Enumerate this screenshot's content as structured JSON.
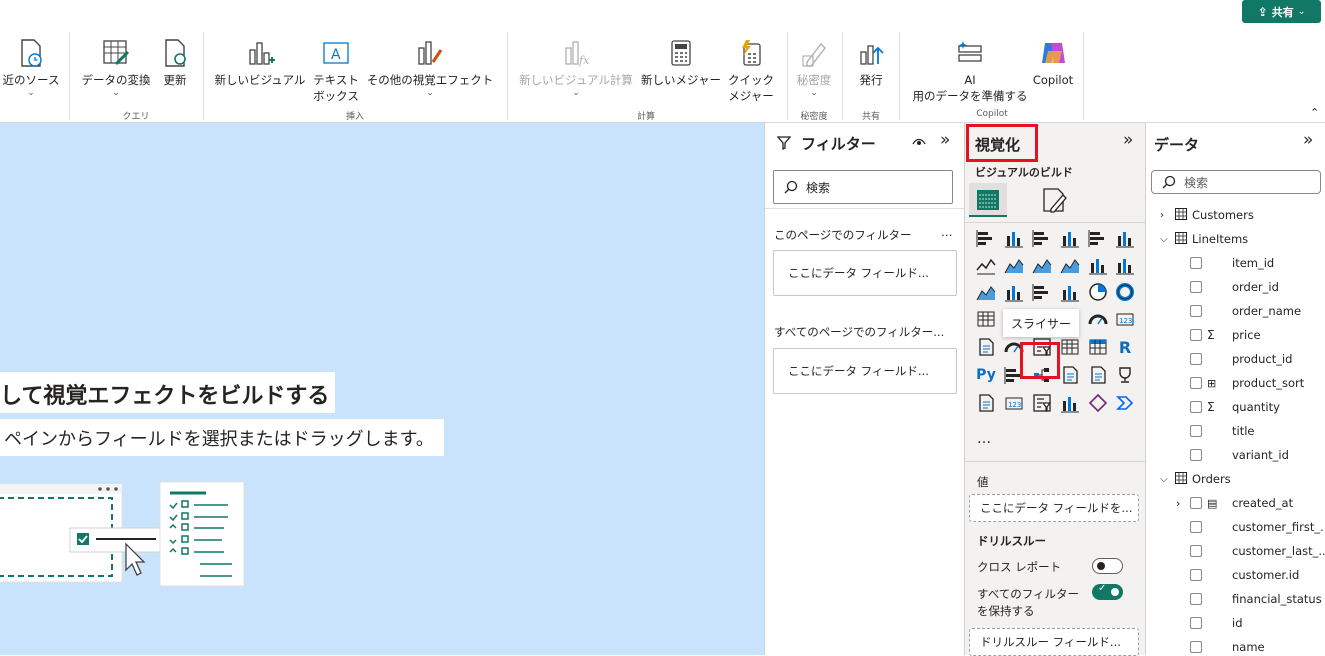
{
  "top": {
    "share_label": "共有"
  },
  "ribbon": {
    "buttons": {
      "recent": "近のソース",
      "transform": "データの変換",
      "refresh": "更新",
      "new_visual": "新しいビジュアル",
      "textbox_1": "テキスト",
      "textbox_2": "ボックス",
      "more_visuals": "その他の視覚エフェクト",
      "new_visual_calc": "新しいビジュアル計算",
      "new_measure": "新しいメジャー",
      "quick_measure_1": "クイック",
      "quick_measure_2": "メジャー",
      "sensitivity": "秘密度",
      "publish": "発行",
      "ai_prep_1": "AI",
      "ai_prep_2": "用のデータを準備する",
      "copilot": "Copilot"
    },
    "groups": {
      "query": "クエリ",
      "insert": "挿入",
      "calc": "計算",
      "sensitivity": "秘密度",
      "share": "共有",
      "copilot": "Copilot"
    }
  },
  "canvas": {
    "heading": "して視覚エフェクトをビルドする",
    "subheading": "ペインからフィールドを選択またはドラッグします。"
  },
  "filters": {
    "title": "フィルター",
    "search_placeholder": "検索",
    "this_page": "このページでのフィルター",
    "all_pages": "すべてのページでのフィルター...",
    "drop_here": "ここにデータ フィールド...",
    "more": "…"
  },
  "viz": {
    "title": "視覚化",
    "build_label": "ビジュアルのビルド",
    "tooltip": "スライサー",
    "more_icon": "…",
    "values_label": "値",
    "values_drop": "ここにデータ フィールドを...",
    "drill_label": "ドリルスルー",
    "cross_report": "クロス レポート",
    "keep_filters_1": "すべてのフィルター",
    "keep_filters_2": "を保持する",
    "drill_drop": "ドリルスルー フィールド...",
    "accent": "#117865",
    "highlight": "#e81123"
  },
  "data": {
    "title": "データ",
    "search_placeholder": "検索",
    "tables": [
      {
        "name": "Customers"
      },
      {
        "name": "LineItems",
        "fields": [
          "item_id",
          "order_id",
          "order_name",
          "price",
          "product_id",
          "product_sort",
          "quantity",
          "title",
          "variant_id"
        ]
      },
      {
        "name": "Orders",
        "fields": [
          "created_at",
          "customer_first_...",
          "customer_last_...",
          "customer.id",
          "financial_status",
          "id",
          "name"
        ]
      }
    ]
  }
}
